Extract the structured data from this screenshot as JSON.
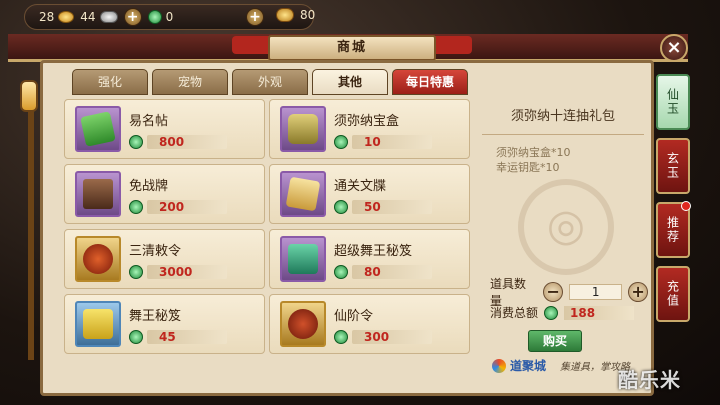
{
  "resources": {
    "gold": "28",
    "silver": "44",
    "jade": "0",
    "ingot": "80"
  },
  "title": "商城",
  "tabs": [
    {
      "label": "强化"
    },
    {
      "label": "宠物"
    },
    {
      "label": "外观"
    },
    {
      "label": "其他"
    },
    {
      "label": "每日特惠"
    }
  ],
  "active_tab": "其他",
  "items": [
    {
      "name": "易名帖",
      "price": "800",
      "icon": "scroll-icon"
    },
    {
      "name": "须弥纳宝盒",
      "price": "10",
      "icon": "treasure-box-icon"
    },
    {
      "name": "免战牌",
      "price": "200",
      "icon": "token-icon"
    },
    {
      "name": "通关文牒",
      "price": "50",
      "icon": "document-icon"
    },
    {
      "name": "三清敕令",
      "price": "3000",
      "icon": "seal-pouch-icon"
    },
    {
      "name": "超级舞王秘笈",
      "price": "80",
      "icon": "book-icon"
    },
    {
      "name": "舞王秘笈",
      "price": "45",
      "icon": "book-icon"
    },
    {
      "name": "仙阶令",
      "price": "300",
      "icon": "pouch-icon"
    }
  ],
  "detail": {
    "pack_title": "须弥纳十连抽礼包",
    "contents": [
      "须弥纳宝盒*10",
      "幸运钥匙*10"
    ],
    "qty_label": "道具数量",
    "qty_value": "1",
    "total_label": "消费总额",
    "total_value": "188",
    "buy_label": "购买"
  },
  "brand": {
    "name": "道聚城",
    "slogan": "集道具，掌攻略"
  },
  "side_tabs": [
    {
      "label": "仙玉"
    },
    {
      "label": "玄玉"
    },
    {
      "label": "推荐"
    },
    {
      "label": "充值"
    }
  ],
  "watermark": "酷乐米"
}
